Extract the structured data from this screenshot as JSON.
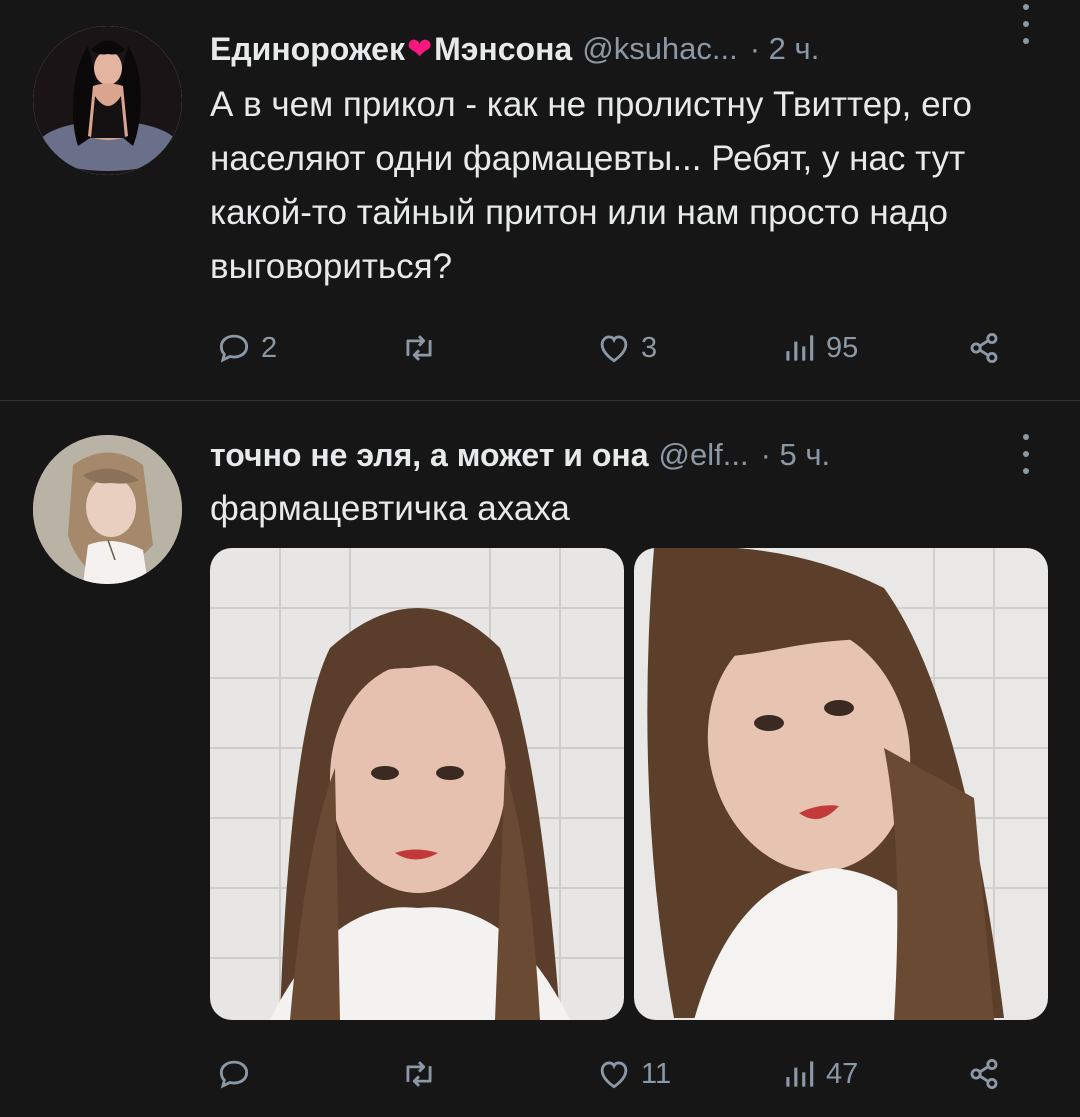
{
  "tweets": [
    {
      "author": {
        "name_part1": "Единорожек",
        "name_part2": "Мэнсона",
        "handle": "@ksuhac...",
        "time": "· 2 ч."
      },
      "text": "А в чем прикол - как не пролистну Твиттер, его населяют одни фармацевты... Ребят, у нас тут какой-то тайный притон или нам просто надо выговориться?",
      "stats": {
        "replies": "2",
        "retweets": "",
        "likes": "3",
        "views": "95"
      }
    },
    {
      "author": {
        "name": "точно не эля, а может и она",
        "handle": "@elf...",
        "time": "· 5 ч."
      },
      "text": "фармацевтичка ахаха",
      "stats": {
        "replies": "",
        "retweets": "",
        "likes": "11",
        "views": "47"
      }
    }
  ],
  "icons": {
    "reply": "reply-icon",
    "retweet": "retweet-icon",
    "like": "heart-icon",
    "views": "views-icon",
    "share": "share-icon",
    "more": "more-vertical-icon",
    "name_emoji": "mending-heart-icon"
  },
  "colors": {
    "background": "#161616",
    "text": "#e7e9ea",
    "secondary": "#8b98a5",
    "divider": "#2f3336"
  }
}
